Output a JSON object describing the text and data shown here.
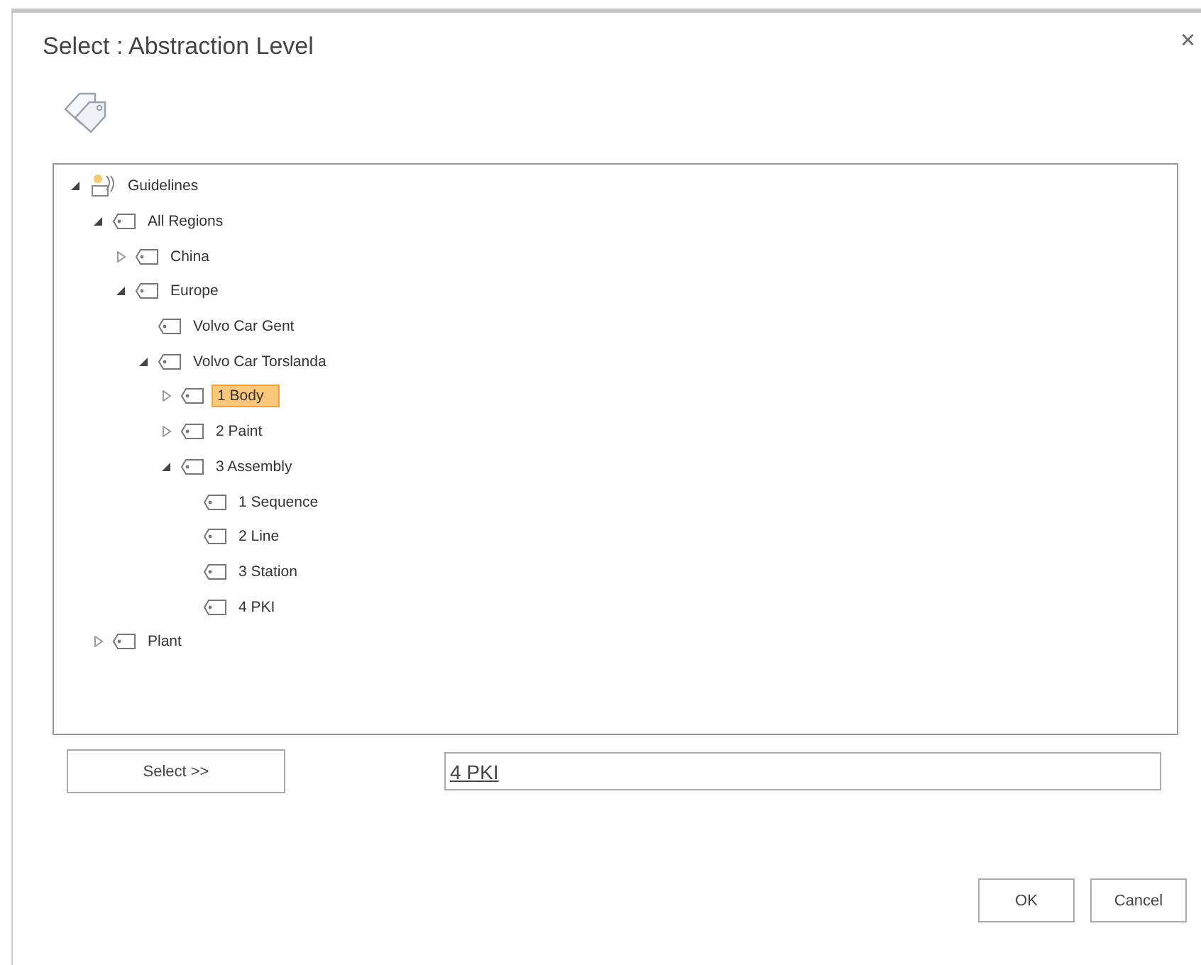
{
  "dialog": {
    "title": "Select : Abstraction Level",
    "close": "×"
  },
  "tree": [
    {
      "label": "Guidelines",
      "kind": "root",
      "expanded": true,
      "selected": false,
      "children": [
        {
          "label": "All Regions",
          "kind": "term",
          "expanded": true,
          "selected": false,
          "children": [
            {
              "label": "China",
              "kind": "term",
              "expanded": false,
              "selected": false
            },
            {
              "label": "Europe",
              "kind": "term",
              "expanded": true,
              "selected": false,
              "children": [
                {
                  "label": "Volvo Car Gent",
                  "kind": "term",
                  "selected": false
                },
                {
                  "label": "Volvo Car Torslanda",
                  "kind": "term",
                  "expanded": true,
                  "selected": false,
                  "children": [
                    {
                      "label": "1 Body",
                      "kind": "term",
                      "expanded": false,
                      "selected": true
                    },
                    {
                      "label": "2 Paint",
                      "kind": "term",
                      "expanded": false,
                      "selected": false
                    },
                    {
                      "label": "3 Assembly",
                      "kind": "term",
                      "expanded": true,
                      "selected": false,
                      "children": [
                        {
                          "label": "1 Sequence",
                          "kind": "term",
                          "selected": false
                        },
                        {
                          "label": "2 Line",
                          "kind": "term",
                          "selected": false
                        },
                        {
                          "label": "3 Station",
                          "kind": "term",
                          "selected": false
                        },
                        {
                          "label": "4 PKI",
                          "kind": "term",
                          "selected": false
                        }
                      ]
                    }
                  ]
                }
              ]
            }
          ]
        },
        {
          "label": "Plant",
          "kind": "term",
          "expanded": false,
          "selected": false
        }
      ]
    }
  ],
  "select_button": "Select >>",
  "selection_field": {
    "value": "4 PKI"
  },
  "buttons": [
    "OK",
    "Cancel"
  ]
}
